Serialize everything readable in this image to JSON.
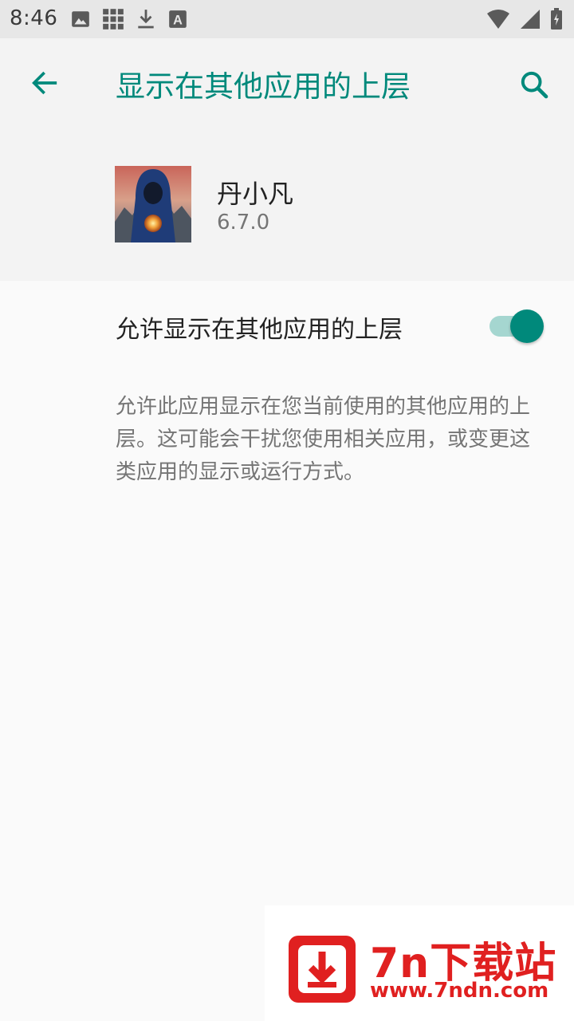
{
  "status_bar": {
    "time": "8:46",
    "left_icons": [
      "image-icon",
      "grid-icon",
      "download-icon",
      "a-box-icon"
    ],
    "right_icons": [
      "wifi-icon",
      "signal-icon",
      "battery-icon"
    ]
  },
  "app_bar": {
    "title": "显示在其他应用的上层",
    "back_icon": "arrow-back-icon",
    "search_icon": "search-icon",
    "accent_color": "#00897b"
  },
  "app_info": {
    "name": "丹小凡",
    "version": "6.7.0"
  },
  "permission": {
    "label": "允许显示在其他应用的上层",
    "enabled": true,
    "description": "允许此应用显示在您当前使用的其他应用的上层。这可能会干扰您使用相关应用，或变更这类应用的显示或运行方式。"
  },
  "watermark": {
    "title": "7n下载站",
    "url": "www.7ndn.com",
    "color": "#e02020"
  }
}
